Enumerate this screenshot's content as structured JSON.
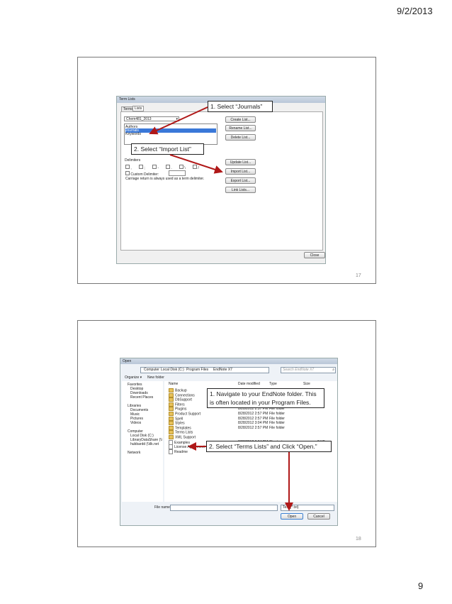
{
  "page": {
    "date": "9/2/2013",
    "number": "9"
  },
  "slide1": {
    "number": "17",
    "window_title": "Term Lists",
    "tabs": [
      "Terms",
      "Lists"
    ],
    "dropdown_value": "Chem481_2013",
    "list_items": [
      "Authors",
      "Journals",
      "Keywords"
    ],
    "buttons": [
      "Create List...",
      "Rename List...",
      "Delete List...",
      "Update List...",
      "Import List...",
      "Export List...",
      "Link Lists..."
    ],
    "delimiters_label": "Delimiters",
    "delimiter_chars": [
      ",",
      ";",
      "-",
      ".",
      "\\",
      "/"
    ],
    "custom_delimiter_label": "Custom Delimiter:",
    "carriage_note": "Carriage return is always used as a term delimiter.",
    "close_button": "Close",
    "callouts": {
      "journals": "1. Select “Journals”",
      "import": "2. Select “Import List”"
    },
    "arrow_color": "#b01818"
  },
  "slide2": {
    "number": "18",
    "window_title": "Open",
    "breadcrumb": [
      "Computer",
      "Local Disk (C:)",
      "Program Files",
      "EndNote X7"
    ],
    "search_placeholder": "Search EndNote X7",
    "toolbar": {
      "organize": "Organize ▾",
      "new_folder": "New folder"
    },
    "nav": {
      "favorites": "Favorites",
      "fav_items": [
        "Desktop",
        "Downloads",
        "Recent Places"
      ],
      "libraries": "Libraries",
      "lib_items": [
        "Documents",
        "Music",
        "Pictures",
        "Videos"
      ],
      "computer": "Computer",
      "comp_items": [
        "Local Disk (C:)",
        "LibraryDataShare (\\\\",
        "hubbardd (\\\\ilk.net"
      ],
      "network": "Network"
    },
    "columns": [
      "Name",
      "Date modified",
      "Type",
      "Size"
    ],
    "files": [
      {
        "name": "Backup",
        "date": "",
        "type": "",
        "size": "",
        "kind": "folder"
      },
      {
        "name": "Connections",
        "date": "",
        "type": "",
        "size": "",
        "kind": "folder"
      },
      {
        "name": "DbSupport",
        "date": "",
        "type": "",
        "size": "",
        "kind": "folder"
      },
      {
        "name": "Filters",
        "date": "8/28/2012 3:04 PM",
        "type": "File folder",
        "size": "",
        "kind": "folder"
      },
      {
        "name": "Plugins",
        "date": "8/28/2012 2:57 PM",
        "type": "File folder",
        "size": "",
        "kind": "folder"
      },
      {
        "name": "Product Support",
        "date": "8/28/2012 2:57 PM",
        "type": "File folder",
        "size": "",
        "kind": "folder"
      },
      {
        "name": "Spell",
        "date": "8/28/2012 2:57 PM",
        "type": "File folder",
        "size": "",
        "kind": "folder"
      },
      {
        "name": "Styles",
        "date": "8/28/2012 3:04 PM",
        "type": "File folder",
        "size": "",
        "kind": "folder"
      },
      {
        "name": "Templates",
        "date": "8/28/2012 2:57 PM",
        "type": "File folder",
        "size": "",
        "kind": "folder"
      },
      {
        "name": "Terms Lists",
        "date": "",
        "type": "",
        "size": "",
        "kind": "folder"
      },
      {
        "name": "XML Support",
        "date": "",
        "type": "",
        "size": "",
        "kind": "folder"
      },
      {
        "name": "Examples",
        "date": "8/28/2012 3:04 PM",
        "type": "Shortcut",
        "size": "2 KB",
        "kind": "doc"
      },
      {
        "name": "License Agreement",
        "date": "6/3/2011 3:25 PM",
        "type": "Text Document",
        "size": "30 KB",
        "kind": "doc"
      },
      {
        "name": "Readme",
        "date": "7/16/2012 4:54 PM",
        "type": "Text Document",
        "size": "6 KB",
        "kind": "doc"
      }
    ],
    "file_name_label": "File name:",
    "file_type_value": "Text (*.txt)",
    "open_button": "Open",
    "cancel_button": "Cancel",
    "callouts": {
      "navigate": "1. Navigate to your EndNote folder. This is often located in your Program Files.",
      "select": "2. Select “Terms Lists” and Click “Open.”"
    },
    "arrow_color": "#b01818"
  }
}
